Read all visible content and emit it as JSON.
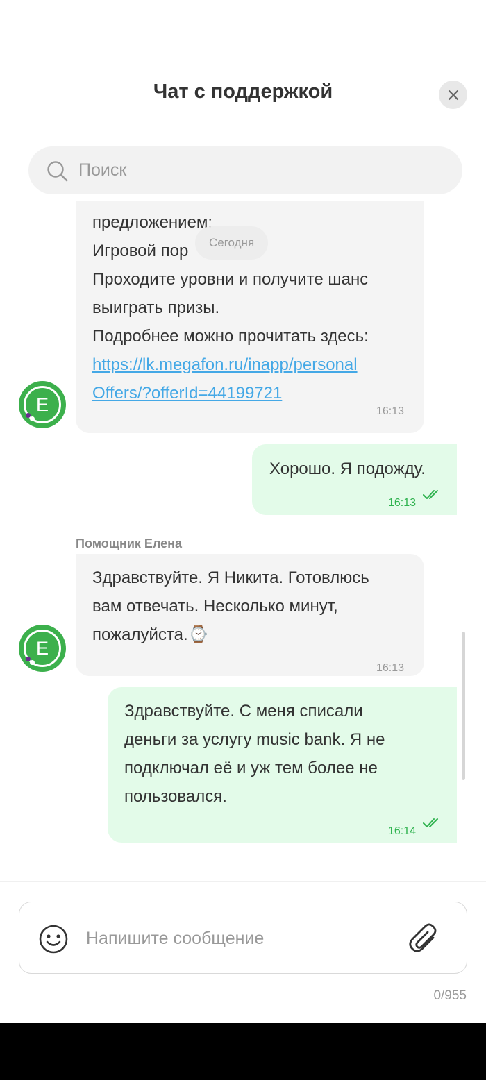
{
  "header": {
    "title": "Чат с поддержкой",
    "close_icon": "close-icon"
  },
  "search": {
    "placeholder": "Поиск",
    "icon": "search-icon"
  },
  "feed": {
    "date_chip": "Сегодня",
    "messages": [
      {
        "direction": "incoming",
        "text_visible": "предложением:\nИгровой пор\nПроходите уровни и получите шанс\nвыиграть призы.\nПодробнее можно прочитать здесь:",
        "link_line1": "https://lk.megafon.ru/inapp/personal",
        "link_line2": "Offers/?offerId=44199721",
        "time": "16:13",
        "avatar_letter": "E"
      },
      {
        "direction": "outgoing",
        "text": "Хорошо. Я подожду.",
        "time": "16:13",
        "status_icon": "double-check-icon"
      },
      {
        "direction": "incoming",
        "sender": "Помощник Елена",
        "text": "Здравствуйте. Я Никита. Готовлюсь\nвам отвечать. Несколько минут,\nпожалуйста.⌚",
        "time": "16:13",
        "avatar_letter": "E"
      },
      {
        "direction": "outgoing",
        "text": "Здравствуйте. С меня списали\nденьги за услугу music bank. Я не\nподключал её и уж тем более не\nпользовался.",
        "time": "16:14",
        "status_icon": "double-check-icon"
      }
    ]
  },
  "composer": {
    "placeholder": "Напишите сообщение",
    "emoji_icon": "smile-icon",
    "attach_icon": "paperclip-icon",
    "counter": "0/955"
  },
  "colors": {
    "incoming_bubble": "#f4f4f4",
    "outgoing_bubble": "#e3fbe9",
    "brand_green": "#3cb04c",
    "time_green": "#2fb24f",
    "link": "#44a8e6"
  }
}
